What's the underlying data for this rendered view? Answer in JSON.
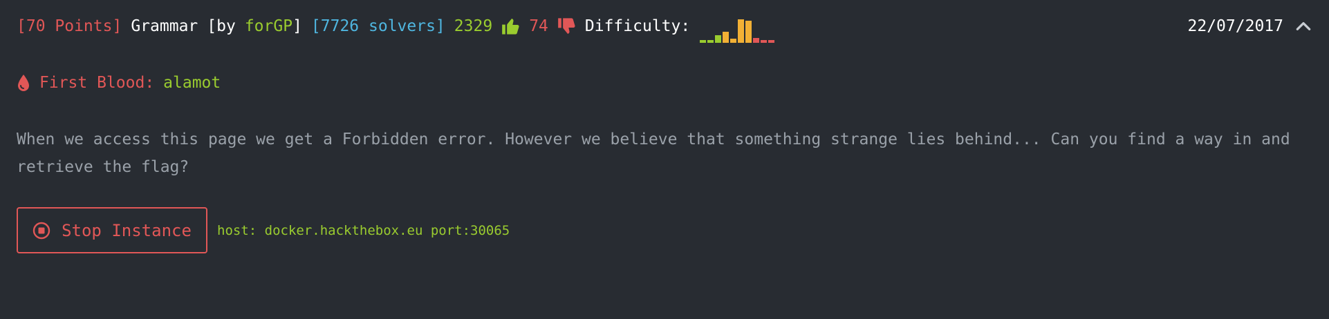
{
  "challenge": {
    "points": "[70 Points]",
    "name": "Grammar",
    "by_prefix": "[by",
    "author": "forGP",
    "by_suffix": "]",
    "solvers": "[7726 solvers]",
    "likes": "2329",
    "dislikes": "74",
    "difficulty_label": "Difficulty:",
    "difficulty_distribution": [
      0.1,
      0.1,
      0.28,
      0.4,
      0.14,
      0.85,
      0.8,
      0.18,
      0.1,
      0.1
    ],
    "difficulty_colors": [
      "#9acc2f",
      "#9acc2f",
      "#9acc2f",
      "#f2b035",
      "#f2b035",
      "#f2b035",
      "#f2b035",
      "#e15757",
      "#e15757",
      "#e15757"
    ],
    "date": "22/07/2017",
    "first_blood_label": "First Blood:",
    "first_blood_user": "alamot",
    "description": "When we access this page we get a Forbidden error. However we believe that something strange lies behind... Can you find a way in and retrieve the flag?",
    "stop_button_label": "Stop Instance",
    "host_info": "host: docker.hackthebox.eu port:30065"
  },
  "icons": {
    "like": "thumbs-up-icon",
    "dislike": "thumbs-down-icon",
    "collapse": "chevron-up-icon",
    "first_blood": "blood-drop-icon",
    "stop": "stop-circle-icon"
  },
  "colors": {
    "background": "#282c32",
    "red": "#e15757",
    "green": "#9acc2f",
    "blue": "#4fb6e0",
    "orange": "#f2b035",
    "text": "#9aa1a9"
  }
}
